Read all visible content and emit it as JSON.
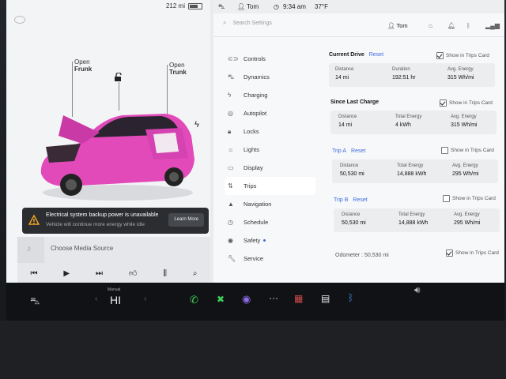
{
  "status_left": {
    "range": "212 mi"
  },
  "callouts": {
    "frunk_open": "Open",
    "frunk_label": "Frunk",
    "trunk_open": "Open",
    "trunk_label": "Trunk"
  },
  "alert": {
    "title": "Electrical system backup power is unavailable",
    "subtitle": "Vehicle will continue more energy while idle",
    "button": "Learn More"
  },
  "media": {
    "source_label": "Choose Media Source"
  },
  "topbar": {
    "user": "Tom",
    "time": "9:34 am",
    "temp": "37°F"
  },
  "search": {
    "placeholder": "Search Settings"
  },
  "profile": {
    "name": "Tom"
  },
  "nav": [
    {
      "label": "Controls",
      "icon": "toggle-icon"
    },
    {
      "label": "Dynamics",
      "icon": "car-icon"
    },
    {
      "label": "Charging",
      "icon": "bolt-icon"
    },
    {
      "label": "Autopilot",
      "icon": "steering-wheel-icon"
    },
    {
      "label": "Locks",
      "icon": "lock-icon"
    },
    {
      "label": "Lights",
      "icon": "sun-icon"
    },
    {
      "label": "Display",
      "icon": "display-icon"
    },
    {
      "label": "Trips",
      "icon": "trips-icon"
    },
    {
      "label": "Navigation",
      "icon": "navigation-icon"
    },
    {
      "label": "Schedule",
      "icon": "clock-icon"
    },
    {
      "label": "Safety",
      "icon": "shield-icon"
    },
    {
      "label": "Service",
      "icon": "wrench-icon"
    }
  ],
  "trips": {
    "show_in_trips_card": "Show in Trips Card",
    "reset": "Reset",
    "current_drive": {
      "title": "Current Drive",
      "distance_label": "Distance",
      "distance": "14 mi",
      "duration_label": "Duration",
      "duration": "192:51 hr",
      "avg_label": "Avg. Energy",
      "avg": "315 Wh/mi"
    },
    "since_last_charge": {
      "title": "Since Last Charge",
      "distance_label": "Distance",
      "distance": "14 mi",
      "total_label": "Total Energy",
      "total": "4 kWh",
      "avg_label": "Avg. Energy",
      "avg": "315 Wh/mi"
    },
    "trip_a": {
      "title": "Trip A",
      "distance_label": "Distance",
      "distance": "50,530 mi",
      "total_label": "Total Energy",
      "total": "14,888 kWh",
      "avg_label": "Avg. Energy",
      "avg": "295 Wh/mi"
    },
    "trip_b": {
      "title": "Trip B",
      "distance_label": "Distance",
      "distance": "50,530 mi",
      "total_label": "Total Energy",
      "total": "14,888 kWh",
      "avg_label": "Avg. Energy",
      "avg": "295 Wh/mi"
    },
    "odometer": "Odometer : 50,530 mi"
  },
  "bottom": {
    "climate_label": "Manual",
    "climate_value": "HI"
  }
}
